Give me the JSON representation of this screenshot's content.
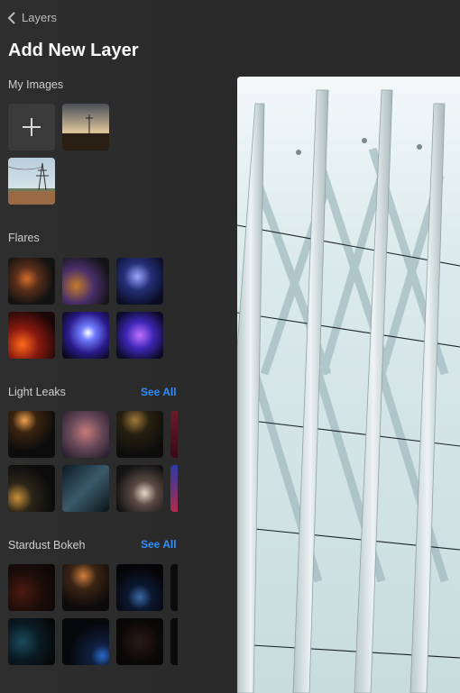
{
  "nav": {
    "back_label": "Layers"
  },
  "header": {
    "title": "Add New Layer"
  },
  "sections": {
    "my_images": {
      "label": "My Images"
    },
    "flares": {
      "label": "Flares"
    },
    "light_leaks": {
      "label": "Light Leaks",
      "see_all": "See All"
    },
    "stardust_bokeh": {
      "label": "Stardust Bokeh",
      "see_all": "See All"
    }
  },
  "colors": {
    "accent": "#2e8fff",
    "panel": "#2a2a2a",
    "tile": "#3b3b3b"
  }
}
